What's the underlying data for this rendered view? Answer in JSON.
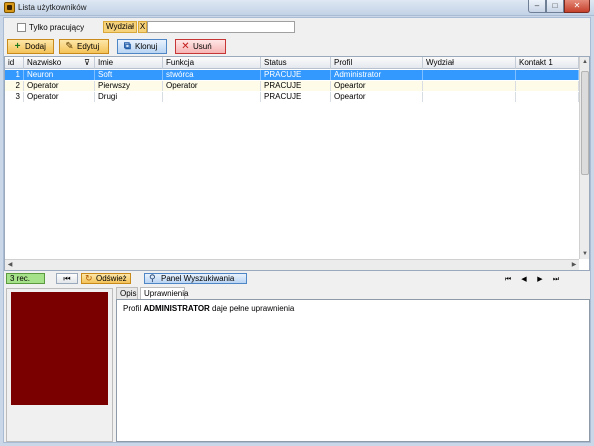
{
  "window": {
    "title": "Lista użytkowników",
    "min": "–",
    "max": "□",
    "close": "✕"
  },
  "filter": {
    "only_working_label": "Tylko pracujący",
    "only_working_checked": false,
    "wydzial_tag": "Wydział",
    "wydzial_clear": "X",
    "value": ""
  },
  "toolbar": {
    "add": "Dodaj",
    "edit": "Edytuj",
    "clone": "Klonuj",
    "delete": "Usuń",
    "add_icon": "plus-icon",
    "edit_icon": "pencil-icon",
    "clone_icon": "clone-icon",
    "delete_icon": "x-icon"
  },
  "grid": {
    "columns": [
      "id",
      "Nazwisko",
      "Imie",
      "Funkcja",
      "Status",
      "Profil",
      "Wydział",
      "Kontakt 1"
    ],
    "rows": [
      [
        "1",
        "Neuron",
        "Soft",
        "stwórca",
        "PRACUJE",
        "Administrator",
        "",
        ""
      ],
      [
        "2",
        "Operator",
        "Pierwszy",
        "Operator",
        "PRACUJE",
        "Opeartor",
        "",
        ""
      ],
      [
        "3",
        "Operator",
        "Drugi",
        "",
        "PRACUJE",
        "Opeartor",
        "",
        ""
      ]
    ],
    "selected_row": 0,
    "sort_icon": "filter-funnel-icon"
  },
  "status": {
    "records": "3 rec.",
    "first_sep": "⏮",
    "refresh": "Odśwież",
    "search_panel": "Panel Wyszukiwania",
    "pager_first": "⏮",
    "pager_prev": "◀",
    "pager_next": "▶",
    "pager_last": "⏭"
  },
  "tabs": [
    "Opis",
    "Uprawnienia"
  ],
  "active_tab": 1,
  "description": {
    "prefix": "Profil ",
    "bold": "ADMINISTRATOR",
    "suffix": " daje pełne uprawnienia"
  },
  "colors": {
    "selection": "#3399ff",
    "photo": "#7a0000",
    "records_badge": "#a6e28a"
  }
}
